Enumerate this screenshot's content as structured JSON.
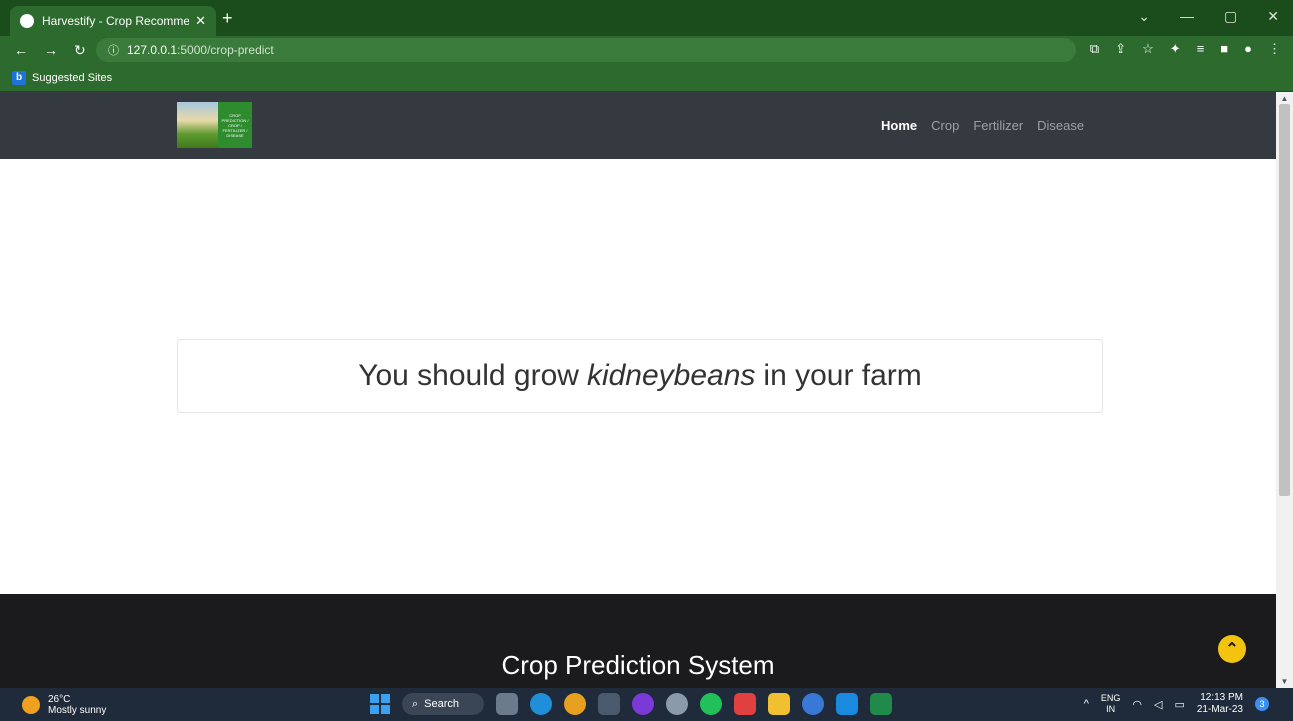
{
  "browser": {
    "tab_title": "Harvestify - Crop Recommendati",
    "tab_close": "✕",
    "new_tab": "+",
    "url_host": "127.0.0.1",
    "url_path": ":5000/crop-predict",
    "bookmark": "Suggested Sites",
    "bookmark_icon_letter": "b"
  },
  "navbar": {
    "logo_text": "CROP PREDICTION / CROP / FERTILIZER / DISEASE",
    "links": [
      "Home",
      "Crop",
      "Fertilizer",
      "Disease"
    ],
    "active_link": "Home"
  },
  "result": {
    "prefix": "You should grow",
    "crop": "kidneybeans",
    "suffix": "in your farm"
  },
  "footer": {
    "title": "Crop Prediction System"
  },
  "taskbar": {
    "temperature": "26°C",
    "weather": "Mostly sunny",
    "search_label": "Search",
    "lang_1": "ENG",
    "lang_2": "IN",
    "time": "12:13 PM",
    "date": "21-Mar-23",
    "notification_count": "3"
  },
  "colors": {
    "chrome_green": "#2d6a2d",
    "navbar_bg": "#343a40",
    "footer_bg": "#1b1b1d",
    "scroll_top_button": "#f2c40f"
  }
}
